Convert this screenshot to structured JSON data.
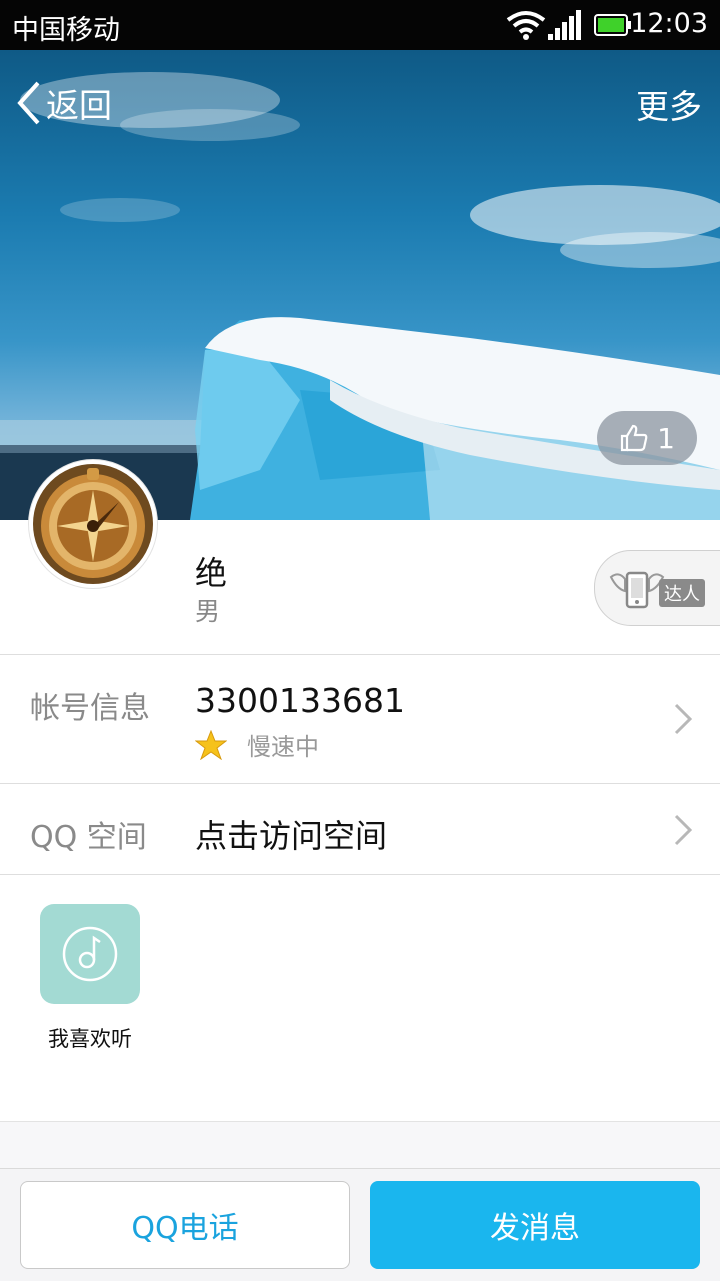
{
  "status_bar": {
    "carrier": "中国移动",
    "time": "12:03"
  },
  "header": {
    "back_label": "返回",
    "more_label": "更多"
  },
  "cover": {
    "like_count": "1"
  },
  "profile": {
    "nickname": "绝",
    "gender": "男",
    "badge_label": "达人"
  },
  "account": {
    "label": "帐号信息",
    "qq_number": "3300133681",
    "status": "慢速中"
  },
  "qzone": {
    "label": "QQ 空间",
    "value": "点击访问空间"
  },
  "apps": {
    "items": [
      {
        "label": "我喜欢听",
        "icon": "music-note-icon"
      }
    ]
  },
  "bottom": {
    "call_label": "QQ电话",
    "message_label": "发消息"
  },
  "colors": {
    "accent": "#1ab6ee",
    "call_text": "#1aa3de"
  }
}
